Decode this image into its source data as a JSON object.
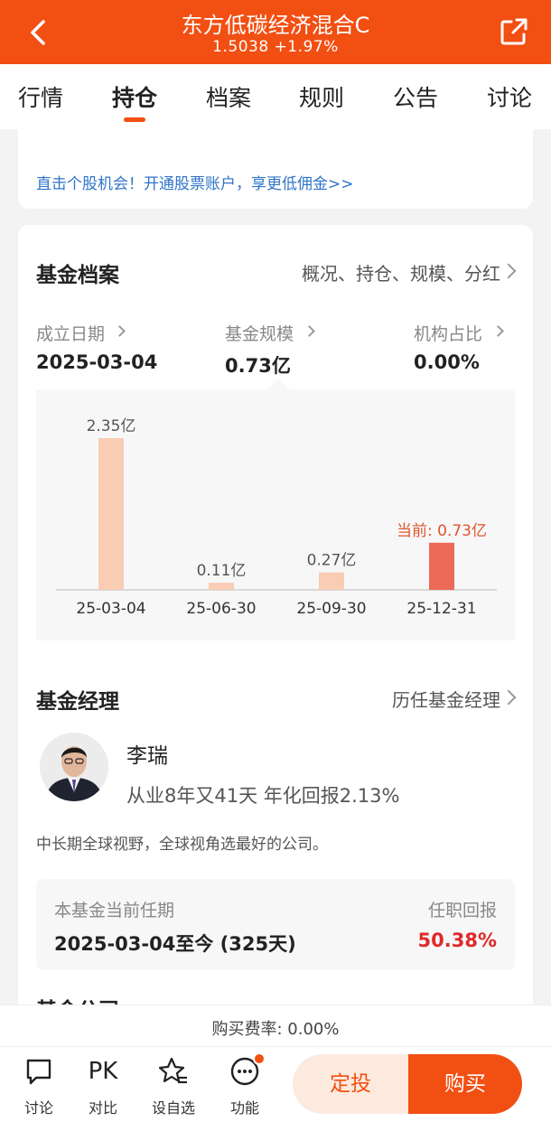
{
  "header": {
    "title": "东方低碳经济混合C",
    "subtitle": "1.5038 +1.97%"
  },
  "tabs": [
    "行情",
    "持仓",
    "档案",
    "规则",
    "公告",
    "讨论"
  ],
  "active_tab": "持仓",
  "promo": {
    "link": "直击个股机会！开通股票账户，享更低佣金>>"
  },
  "fund_profile": {
    "title": "基金档案",
    "link": "概况、持仓、规模、分红",
    "stats": [
      {
        "label": "成立日期",
        "value": "2025-03-04"
      },
      {
        "label": "基金规模",
        "value": "0.73亿"
      },
      {
        "label": "机构占比",
        "value": "0.00%"
      }
    ]
  },
  "chart_data": {
    "type": "bar",
    "categories": [
      "25-03-04",
      "25-06-30",
      "25-09-30",
      "25-12-31"
    ],
    "values": [
      2.35,
      0.11,
      0.27,
      0.73
    ],
    "data_labels": [
      "2.35亿",
      "0.11亿",
      "0.27亿",
      "当前: 0.73亿"
    ],
    "colors": [
      "#f8cdb3",
      "#f8cdb3",
      "#f8cdb3",
      "#ec6b56"
    ],
    "ylim": [
      0,
      2.35
    ],
    "grid": false
  },
  "manager": {
    "title": "基金经理",
    "link": "历任基金经理",
    "name": "李瑞",
    "desc": "从业8年又41天 年化回报2.13%",
    "motto": "中长期全球视野，全球视角选最好的公司。",
    "tenure_label": "本基金当前任期",
    "tenure_value": "2025-03-04至今 (325天)",
    "return_label": "任职回报",
    "return_value": "50.38%"
  },
  "partial_section": "基金公司",
  "fee": "购买费率: 0.00%",
  "bottom": {
    "items": [
      {
        "icon": "chat-icon",
        "label": "讨论"
      },
      {
        "icon": "pk-icon",
        "label": "对比",
        "text": "PK"
      },
      {
        "icon": "star-list-icon",
        "label": "设自选"
      },
      {
        "icon": "more-icon",
        "label": "功能"
      }
    ],
    "dingtou": "定投",
    "buy": "购买"
  },
  "colors": {
    "brand": "#f24f12",
    "link": "#2f74c8",
    "positive": "#e0292a"
  }
}
